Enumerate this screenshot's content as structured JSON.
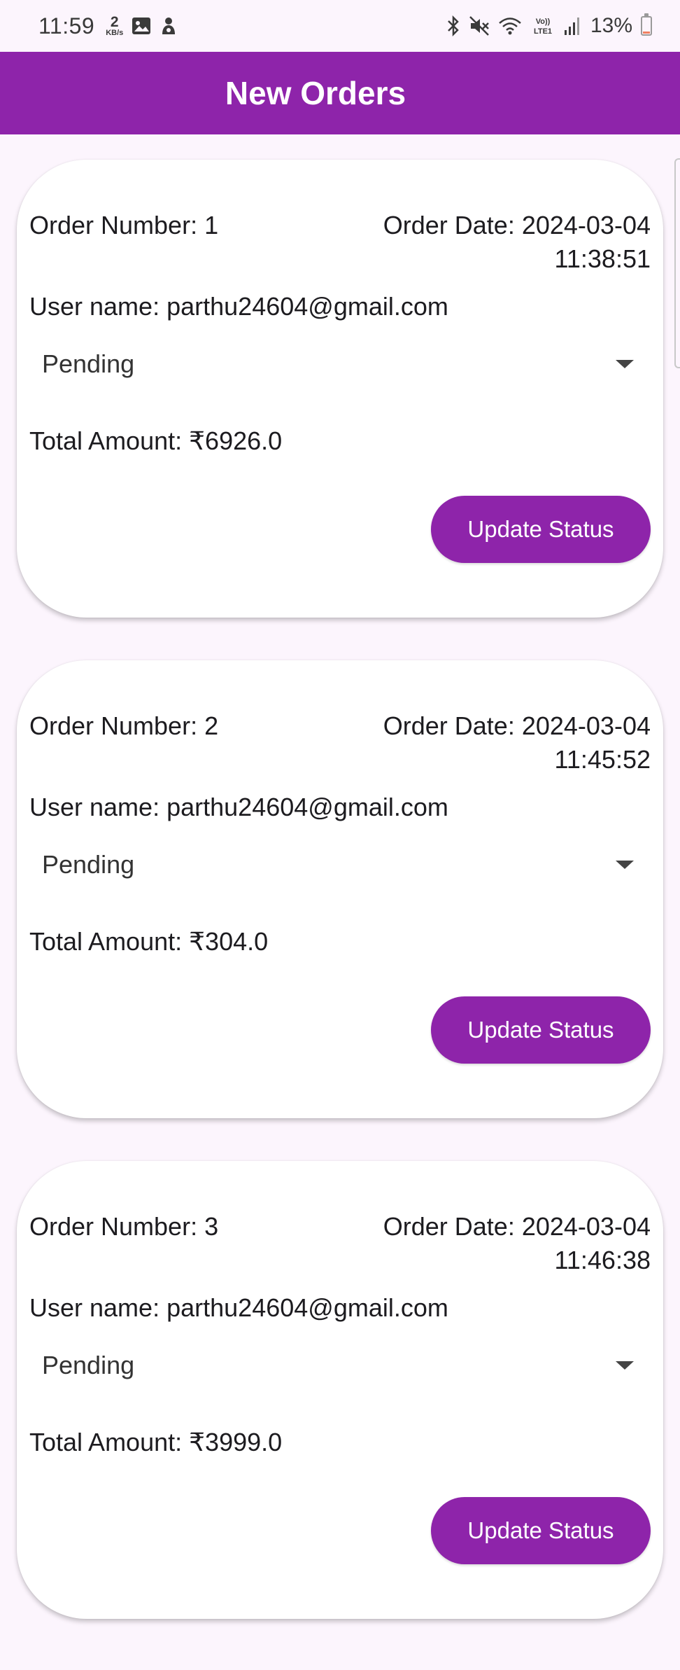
{
  "status_bar": {
    "time": "11:59",
    "speed_value": "2",
    "speed_unit": "KB/s",
    "battery_percent": "13%",
    "battery_level": 0.13
  },
  "app_bar": {
    "title": "New Orders",
    "background_color": "#8e24aa"
  },
  "labels": {
    "order_number": "Order Number:",
    "order_date": "Order Date:",
    "user_name": "User name:",
    "total_amount": "Total Amount:",
    "update_button": "Update Status"
  },
  "orders": [
    {
      "number": "1",
      "date": "2024-03-04",
      "time": "11:38:51",
      "user": "parthu24604@gmail.com",
      "status": "Pending",
      "total": "₹6926.0"
    },
    {
      "number": "2",
      "date": "2024-03-04",
      "time": "11:45:52",
      "user": "parthu24604@gmail.com",
      "status": "Pending",
      "total": "₹304.0"
    },
    {
      "number": "3",
      "date": "2024-03-04",
      "time": "11:46:38",
      "user": "parthu24604@gmail.com",
      "status": "Pending",
      "total": "₹3999.0"
    }
  ]
}
